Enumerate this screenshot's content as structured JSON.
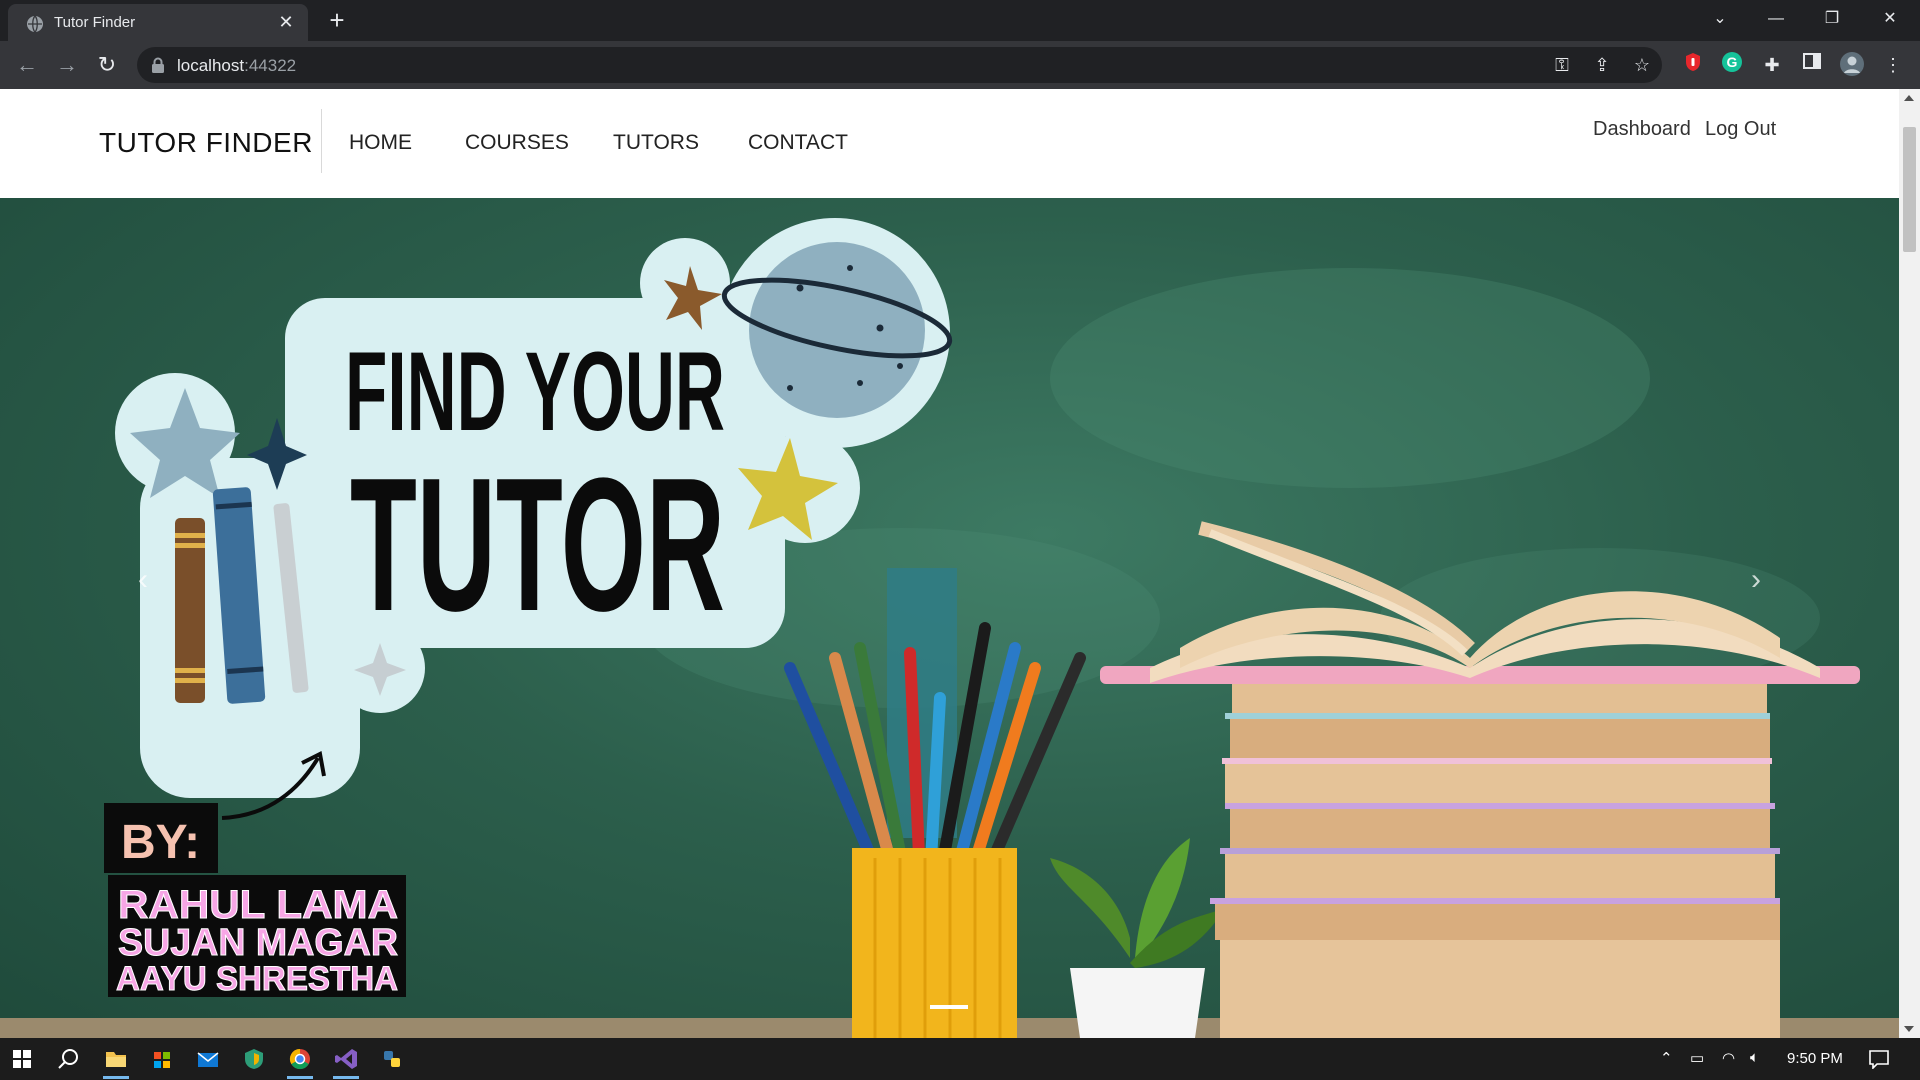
{
  "browser": {
    "tab_title": "Tutor Finder",
    "tab_close": "✕",
    "new_tab": "+",
    "url_host": "localhost",
    "url_port": ":44322"
  },
  "site": {
    "brand": "TUTOR FINDER",
    "nav": [
      "HOME",
      "COURSES",
      "TUTORS",
      "CONTACT"
    ],
    "right_links": [
      "Dashboard",
      "Log Out"
    ]
  },
  "hero": {
    "headline_line1": "FIND YOUR",
    "headline_line2": "TUTOR",
    "by_label": "BY:",
    "authors": [
      "RAHUL LAMA",
      "SUJAN MAGAR",
      "AAYU SHRESTHA"
    ],
    "prev_symbol": "‹",
    "next_symbol": "›",
    "active_slide": 1,
    "slide_count": 1
  },
  "taskbar": {
    "time": "9:50 PM"
  },
  "colors": {
    "chalkboard": "#2c5f4c",
    "sticker": "#d9f0f2",
    "author_pink": "#f7a6e6",
    "pencil_cup": "#f2b51c"
  }
}
